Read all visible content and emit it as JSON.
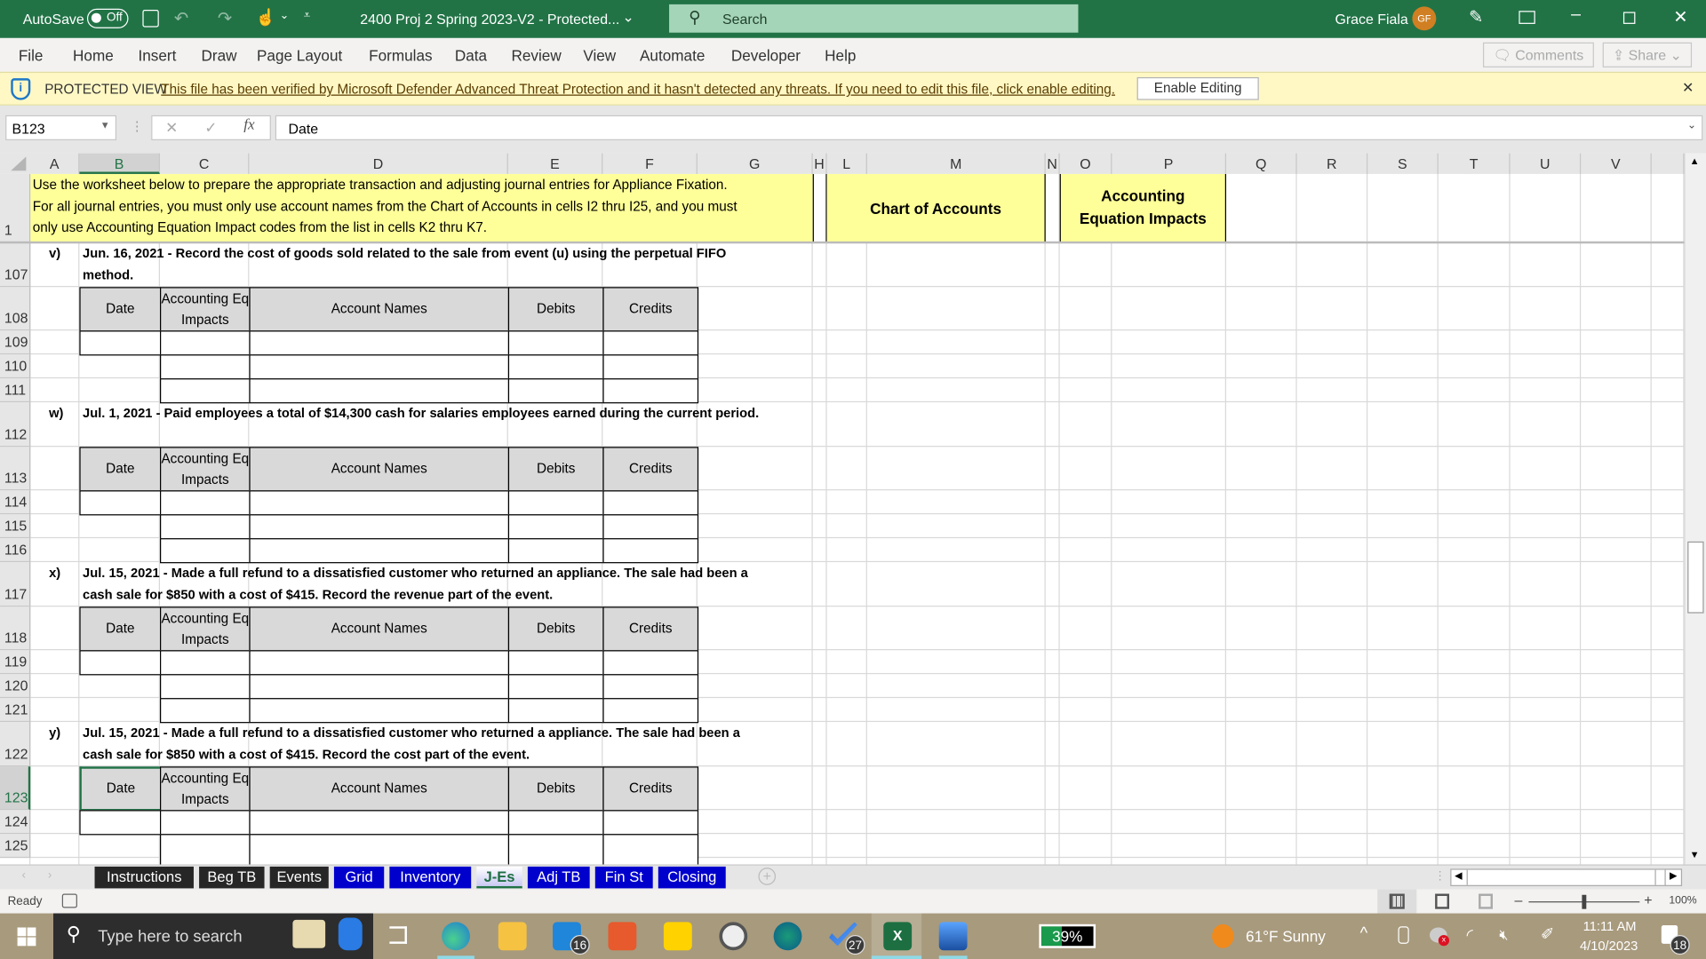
{
  "titlebar": {
    "autosave_label": "AutoSave",
    "autosave_state": "Off",
    "doc_title": "2400 Proj 2 Spring 2023-V2  -  Protected...",
    "search_placeholder": "Search",
    "user_name": "Grace Fiala",
    "user_initials": "GF"
  },
  "ribbon": {
    "tabs": [
      "File",
      "Home",
      "Insert",
      "Draw",
      "Page Layout",
      "Formulas",
      "Data",
      "Review",
      "View",
      "Automate",
      "Developer",
      "Help"
    ],
    "comments": "Comments",
    "share": "Share"
  },
  "protected_view": {
    "label": "PROTECTED VIEW",
    "message": "This file has been verified by Microsoft Defender Advanced Threat Protection and it hasn't detected any threats. If you need to edit this file, click enable editing.",
    "button": "Enable Editing"
  },
  "formula_bar": {
    "name_box": "B123",
    "formula": "Date"
  },
  "columns": [
    "A",
    "B",
    "C",
    "D",
    "E",
    "F",
    "G",
    "H",
    "L",
    "M",
    "N",
    "O",
    "P",
    "Q",
    "R",
    "S",
    "T",
    "U",
    "V"
  ],
  "selected_column": "B",
  "row1": {
    "row": "1",
    "instructions": [
      "Use the worksheet below to prepare the appropriate transaction and adjusting journal entries for Appliance Fixation.",
      "For all journal entries, you must only use account names from the Chart of Accounts in cells I2 thru I25, and you must",
      "only use Accounting Equation Impact codes from the list in cells K2 thru K7."
    ],
    "chart_of_accounts": "Chart of Accounts",
    "acct_eq_impacts": [
      "Accounting",
      "Equation Impacts"
    ]
  },
  "journal_headers": [
    "Date",
    "Accounting Eq Impacts",
    "Account Names",
    "Debits",
    "Credits"
  ],
  "entries": [
    {
      "letter": "v)",
      "lines": [
        "Jun. 16, 2021 - Record the cost of goods sold related to the sale from event (u) using the perpetual FIFO",
        "method."
      ],
      "rows": [
        "107",
        "108",
        "109",
        "110",
        "111"
      ]
    },
    {
      "letter": "w)",
      "lines": [
        "Jul. 1, 2021 - Paid employees a total of $14,300 cash for salaries employees earned during the current period."
      ],
      "rows": [
        "112",
        "113",
        "114",
        "115",
        "116"
      ]
    },
    {
      "letter": "x)",
      "lines": [
        "Jul. 15, 2021 - Made a full refund to a dissatisfied customer who returned an appliance. The sale had been a",
        "cash sale for $850 with a cost of $415. Record the revenue part of the event."
      ],
      "rows": [
        "117",
        "118",
        "119",
        "120",
        "121"
      ]
    },
    {
      "letter": "y)",
      "lines": [
        "Jul. 15, 2021 - Made a full refund to a dissatisfied customer who returned a appliance. The sale had been a",
        "cash sale for $850 with a cost of $415. Record the cost part of the event."
      ],
      "rows": [
        "122",
        "123",
        "124",
        "125"
      ]
    }
  ],
  "sheet_tabs": [
    {
      "label": "Instructions",
      "color": "#262626"
    },
    {
      "label": "Beg TB",
      "color": "#262626"
    },
    {
      "label": "Events",
      "color": "#262626"
    },
    {
      "label": "Grid",
      "color": "#0000cc"
    },
    {
      "label": "Inventory",
      "color": "#0000cc"
    },
    {
      "label": "J-Es",
      "color": "#0000cc",
      "active": true
    },
    {
      "label": "Adj TB",
      "color": "#0000cc"
    },
    {
      "label": "Fin St",
      "color": "#0000cc"
    },
    {
      "label": "Closing",
      "color": "#0000cc"
    }
  ],
  "status": {
    "ready": "Ready",
    "zoom": "100%",
    "zoom_level_percent": 100
  },
  "taskbar": {
    "search_placeholder": "Type here to search",
    "mail_badge": "16",
    "todo_badge": "27",
    "battery": "39%",
    "battery_percent": 39,
    "weather": "61°F  Sunny",
    "time": "11:11 AM",
    "date": "4/10/2023",
    "notifications": "18"
  },
  "colors": {
    "excel_green": "#217346",
    "protected_yellow": "#fff8c5",
    "cell_yellow": "#ffff99",
    "header_gray": "#d9d9d9"
  }
}
